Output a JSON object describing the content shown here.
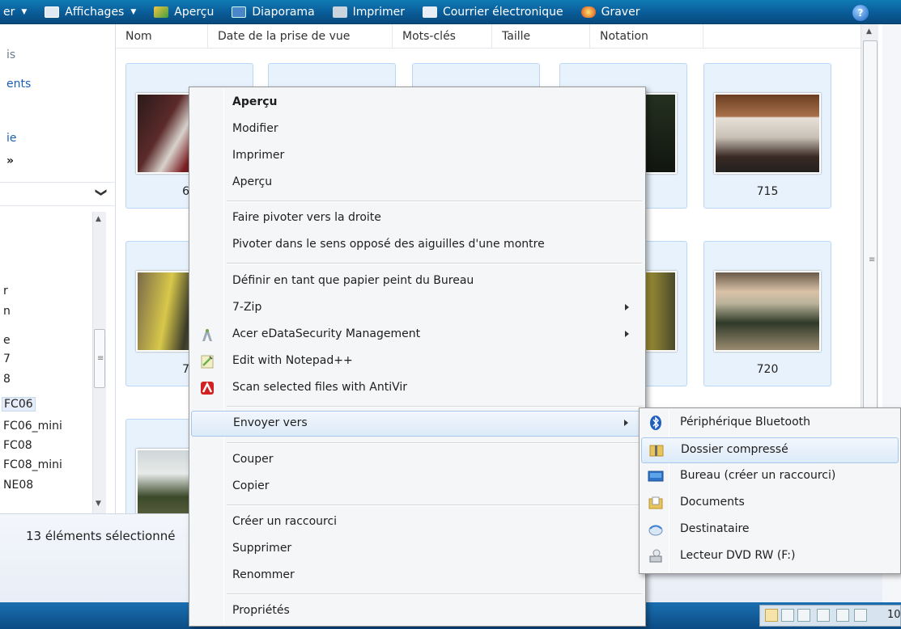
{
  "toolbar": {
    "items": [
      {
        "label": "er",
        "icon": "organize-icon",
        "arrow": "▼"
      },
      {
        "label": "Affichages",
        "icon": "views-icon",
        "arrow": "▼"
      },
      {
        "label": "Aperçu",
        "icon": "preview-icon"
      },
      {
        "label": "Diaporama",
        "icon": "slideshow-icon"
      },
      {
        "label": "Imprimer",
        "icon": "print-icon"
      },
      {
        "label": "Courrier électronique",
        "icon": "email-icon"
      },
      {
        "label": "Graver",
        "icon": "burn-icon"
      }
    ],
    "help": "?"
  },
  "left_pane": {
    "favorites": [
      {
        "label": "is",
        "color": "#6e7b8a"
      },
      {
        "label": "ents",
        "color": "#1a5fb4"
      },
      {
        "label": "ie",
        "color": "#1a5fb4"
      },
      {
        "label": "»",
        "color": "#1e1e1e"
      }
    ],
    "chevron": "❯",
    "tree": [
      "r",
      "n",
      "e",
      "7",
      "8",
      "FC06",
      "FC06_mini",
      "FC08",
      "FC08_mini",
      "NE08"
    ],
    "selected_index": 5
  },
  "columns": [
    "Nom",
    "Date de la prise de vue",
    "Mots-clés",
    "Taille",
    "Notation"
  ],
  "thumbnails": [
    {
      "label": "69"
    },
    {
      "label": ""
    },
    {
      "label": ""
    },
    {
      "label": ""
    },
    {
      "label": "715"
    },
    {
      "label": "71"
    },
    {
      "label": ""
    },
    {
      "label": ""
    },
    {
      "label": ""
    },
    {
      "label": "720"
    },
    {
      "label": ""
    }
  ],
  "status": {
    "text": "13 éléments sélectionné"
  },
  "tray": {
    "number": "10"
  },
  "context_menu": {
    "items": [
      {
        "label": "Aperçu",
        "bold": true
      },
      {
        "label": "Modifier"
      },
      {
        "label": "Imprimer"
      },
      {
        "label": "Aperçu"
      },
      {
        "label": "Faire pivoter vers la droite"
      },
      {
        "label": "Pivoter dans le sens opposé des aiguilles d'une montre"
      },
      {
        "label": "Définir en tant que papier peint du Bureau"
      },
      {
        "label": "7-Zip",
        "submenu": true
      },
      {
        "label": "Acer eDataSecurity Management",
        "submenu": true,
        "icon": "acer-edatasecurity-icon"
      },
      {
        "label": "Edit with Notepad++",
        "icon": "notepad-plus-plus-icon"
      },
      {
        "label": "Scan selected files with AntiVir",
        "icon": "antivir-icon"
      },
      {
        "label": "Envoyer vers",
        "submenu": true,
        "highlighted": true
      },
      {
        "label": "Couper"
      },
      {
        "label": "Copier"
      },
      {
        "label": "Créer un raccourci"
      },
      {
        "label": "Supprimer"
      },
      {
        "label": "Renommer"
      },
      {
        "label": "Propriétés"
      }
    ]
  },
  "send_to_menu": {
    "items": [
      {
        "label": "Périphérique Bluetooth",
        "icon": "bluetooth-icon"
      },
      {
        "label": "Dossier compressé",
        "icon": "zip-folder-icon",
        "highlighted": true
      },
      {
        "label": "Bureau (créer un raccourci)",
        "icon": "desktop-icon"
      },
      {
        "label": "Documents",
        "icon": "documents-folder-icon"
      },
      {
        "label": "Destinataire",
        "icon": "mail-recipient-icon"
      },
      {
        "label": "Lecteur DVD RW (F:)",
        "icon": "dvd-drive-icon"
      }
    ]
  }
}
